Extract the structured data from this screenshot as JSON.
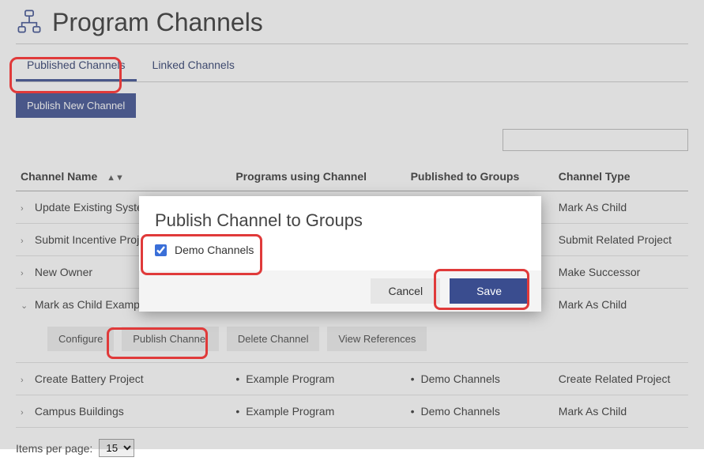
{
  "header": {
    "title": "Program Channels"
  },
  "tabs": {
    "published": "Published Channels",
    "linked": "Linked Channels"
  },
  "buttons": {
    "publish_new": "Publish New Channel"
  },
  "search": {
    "value": ""
  },
  "table": {
    "columns": {
      "channel_name": "Channel Name",
      "programs": "Programs using Channel",
      "groups": "Published to Groups",
      "type": "Channel Type"
    },
    "sort_indicator": "▲▼",
    "rows": [
      {
        "name": "Update Existing Syste",
        "programs": "",
        "groups": "",
        "type": "Mark As Child",
        "expanded": false
      },
      {
        "name": "Submit Incentive Proj",
        "programs": "",
        "groups": "",
        "type": "Submit Related Project",
        "expanded": false
      },
      {
        "name": "New Owner",
        "programs": "",
        "groups": "",
        "type": "Make Successor",
        "expanded": false
      },
      {
        "name": "Mark as Child Exampl",
        "programs": "",
        "groups": "",
        "type": "Mark As Child",
        "expanded": true,
        "actions": {
          "configure": "Configure",
          "publish": "Publish Channel",
          "delete": "Delete Channel",
          "refs": "View References"
        }
      },
      {
        "name": "Create Battery Project",
        "programs": "Example Program",
        "groups": "Demo Channels",
        "type": "Create Related Project",
        "expanded": false
      },
      {
        "name": "Campus Buildings",
        "programs": "Example Program",
        "groups": "Demo Channels",
        "type": "Mark As Child",
        "expanded": false
      }
    ]
  },
  "pager": {
    "label": "Items per page:",
    "value": "15"
  },
  "modal": {
    "title": "Publish Channel to Groups",
    "option": "Demo Channels",
    "checked": true,
    "cancel": "Cancel",
    "save": "Save"
  }
}
